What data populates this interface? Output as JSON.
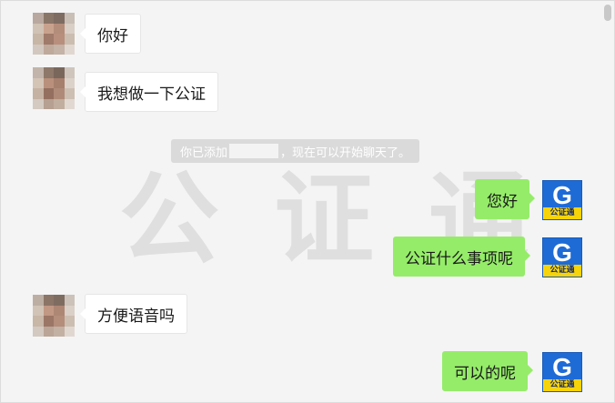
{
  "watermark": [
    "公",
    "证",
    "通"
  ],
  "system_notice": {
    "prefix": "你已添加",
    "suffix": "，现在可以开始聊天了。"
  },
  "logo": {
    "letter": "G",
    "caption": "公证通",
    "colors": {
      "blue": "#1e6bd6",
      "yellow": "#f7d40a"
    }
  },
  "messages": [
    {
      "side": "left",
      "text": "你好"
    },
    {
      "side": "left",
      "text": "我想做一下公证"
    },
    {
      "side": "right",
      "text": "您好"
    },
    {
      "side": "right",
      "text": "公证什么事项呢"
    },
    {
      "side": "left",
      "text": "方便语音吗"
    },
    {
      "side": "right",
      "text": "可以的呢"
    }
  ],
  "colors": {
    "right_bubble": "#95ec69",
    "left_bubble": "#ffffff",
    "background": "#f4f4f4"
  }
}
